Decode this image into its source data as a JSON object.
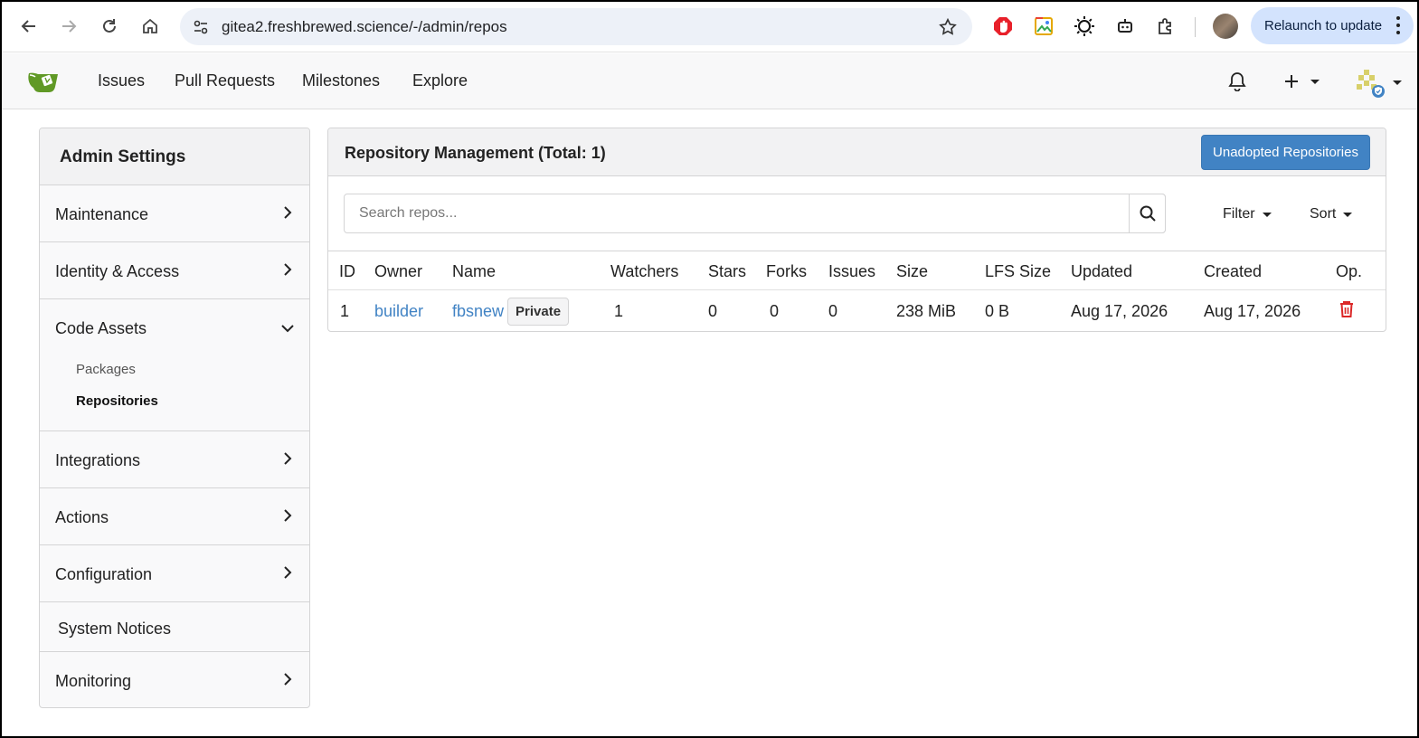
{
  "browser": {
    "url": "gitea2.freshbrewed.science/-/admin/repos",
    "relaunch_label": "Relaunch to update"
  },
  "topnav": {
    "items": [
      "Issues",
      "Pull Requests",
      "Milestones",
      "Explore"
    ]
  },
  "sidebar": {
    "title": "Admin Settings",
    "items": [
      {
        "label": "Maintenance"
      },
      {
        "label": "Identity & Access"
      },
      {
        "label": "Code Assets",
        "children": [
          "Packages",
          "Repositories"
        ],
        "active_child": "Repositories"
      },
      {
        "label": "Integrations"
      },
      {
        "label": "Actions"
      },
      {
        "label": "Configuration"
      },
      {
        "label": "System Notices"
      },
      {
        "label": "Monitoring"
      }
    ]
  },
  "main": {
    "title": "Repository Management (Total: 1)",
    "unadopted_label": "Unadopted Repositories",
    "search_placeholder": "Search repos...",
    "filter_label": "Filter",
    "sort_label": "Sort",
    "columns": [
      "ID",
      "Owner",
      "Name",
      "Watchers",
      "Stars",
      "Forks",
      "Issues",
      "Size",
      "LFS Size",
      "Updated",
      "Created",
      "Op."
    ],
    "rows": [
      {
        "id": "1",
        "owner": "builder",
        "name": "fbsnew",
        "visibility": "Private",
        "watchers": "1",
        "stars": "0",
        "forks": "0",
        "issues": "0",
        "size": "238 MiB",
        "lfs_size": "0 B",
        "updated": "Aug 17, 2026",
        "created": "Aug 17, 2026"
      }
    ]
  },
  "colors": {
    "link": "#4183c4",
    "primary_button": "#4183c4",
    "danger": "#db2828",
    "relaunch_bg": "#d3e3fd"
  },
  "icons": {
    "delete": "trash-icon",
    "search": "search-icon"
  }
}
